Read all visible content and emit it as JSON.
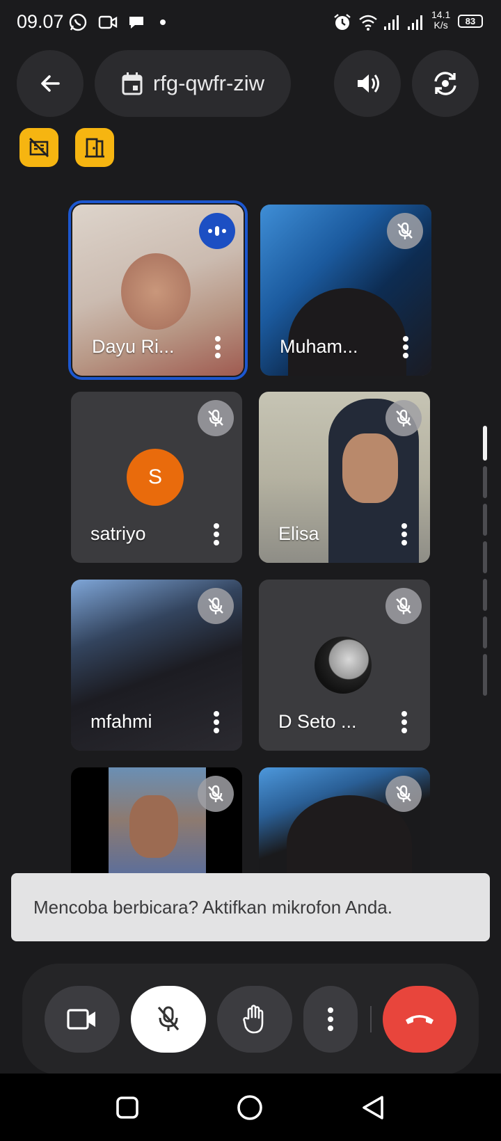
{
  "status_bar": {
    "time": "09.07",
    "network_speed": "14.1\nK/s",
    "battery": "83",
    "icons": [
      "whatsapp-icon",
      "video-icon",
      "chat-icon",
      "dot-icon",
      "alarm-icon",
      "wifi-icon",
      "signal-icon",
      "signal-icon"
    ]
  },
  "header": {
    "meeting_code": "rfg-qwfr-ziw",
    "icons": [
      "back-arrow-icon",
      "calendar-icon",
      "speaker-icon",
      "switch-camera-icon"
    ]
  },
  "badges": [
    "no-filter-icon",
    "room-icon"
  ],
  "participants": [
    {
      "name": "Dayu Ri...",
      "state": "speaking"
    },
    {
      "name": "Muham...",
      "state": "muted"
    },
    {
      "name": "satriyo",
      "state": "muted",
      "avatar_letter": "S"
    },
    {
      "name": "Elisa",
      "state": "muted"
    },
    {
      "name": "mfahmi",
      "state": "muted"
    },
    {
      "name": "D Seto ...",
      "state": "muted"
    },
    {
      "name": "",
      "state": "muted"
    },
    {
      "name": "",
      "state": "muted"
    }
  ],
  "toast": {
    "message": "Mencoba berbicara? Aktifkan mikrofon Anda."
  },
  "controls": {
    "icons": [
      "camera-icon",
      "mic-off-icon",
      "raise-hand-icon",
      "more-icon",
      "end-call-icon"
    ],
    "end_call_color": "#e8453c"
  },
  "nav_bar": {
    "icons": [
      "recent-apps-icon",
      "home-icon",
      "back-icon"
    ]
  }
}
